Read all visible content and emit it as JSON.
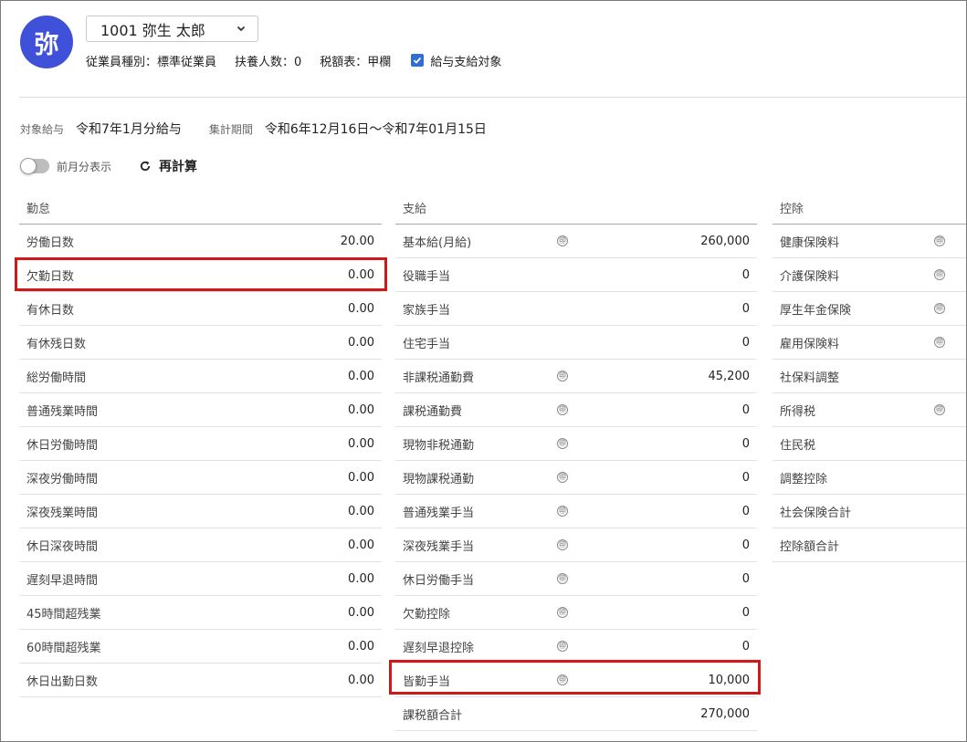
{
  "employee": {
    "avatar_char": "弥",
    "selector_value": "1001 弥生 太郎",
    "type": "従業員種別：標準従業員",
    "dependents": "扶養人数：0",
    "tax_table": "税額表：甲欄",
    "payroll_target_label": "給与支給対象",
    "payroll_target_checked": true
  },
  "period": {
    "target_label": "対象給与",
    "target_value": "令和7年1月分給与",
    "range_label": "集計期間",
    "range_value": "令和6年12月16日〜令和7年01月15日"
  },
  "controls": {
    "prev_month_label": "前月分表示",
    "recalc_label": "再計算"
  },
  "attendance": {
    "header": "勤怠",
    "rows": [
      {
        "name": "労働日数",
        "value": "20.00"
      },
      {
        "name": "欠勤日数",
        "value": "0.00"
      },
      {
        "name": "有休日数",
        "value": "0.00"
      },
      {
        "name": "有休残日数",
        "value": "0.00"
      },
      {
        "name": "総労働時間",
        "value": "0.00"
      },
      {
        "name": "普通残業時間",
        "value": "0.00"
      },
      {
        "name": "休日労働時間",
        "value": "0.00"
      },
      {
        "name": "深夜労働時間",
        "value": "0.00"
      },
      {
        "name": "深夜残業時間",
        "value": "0.00"
      },
      {
        "name": "休日深夜時間",
        "value": "0.00"
      },
      {
        "name": "遅刻早退時間",
        "value": "0.00"
      },
      {
        "name": "45時間超残業",
        "value": "0.00"
      },
      {
        "name": "60時間超残業",
        "value": "0.00"
      },
      {
        "name": "休日出勤日数",
        "value": "0.00"
      }
    ]
  },
  "payment": {
    "header": "支給",
    "rows": [
      {
        "name": "基本給(月給)",
        "value": "260,000",
        "mark": "㊞"
      },
      {
        "name": "役職手当",
        "value": "0",
        "mark": ""
      },
      {
        "name": "家族手当",
        "value": "0",
        "mark": ""
      },
      {
        "name": "住宅手当",
        "value": "0",
        "mark": ""
      },
      {
        "name": "非課税通勤費",
        "value": "45,200",
        "mark": "㊞"
      },
      {
        "name": "課税通勤費",
        "value": "0",
        "mark": "㊞"
      },
      {
        "name": "現物非税通勤",
        "value": "0",
        "mark": "㊞"
      },
      {
        "name": "現物課税通勤",
        "value": "0",
        "mark": "㊞"
      },
      {
        "name": "普通残業手当",
        "value": "0",
        "mark": "㊞"
      },
      {
        "name": "深夜残業手当",
        "value": "0",
        "mark": "㊞"
      },
      {
        "name": "休日労働手当",
        "value": "0",
        "mark": "㊞"
      },
      {
        "name": "欠勤控除",
        "value": "0",
        "mark": "㊞"
      },
      {
        "name": "遅刻早退控除",
        "value": "0",
        "mark": "㊞"
      },
      {
        "name": "皆勤手当",
        "value": "10,000",
        "mark": "㊞"
      },
      {
        "name": "課税額合計",
        "value": "270,000",
        "mark": ""
      }
    ]
  },
  "deduction": {
    "header": "控除",
    "rows": [
      {
        "name": "健康保険料",
        "value": "",
        "mark": "㊞"
      },
      {
        "name": "介護保険料",
        "value": "",
        "mark": "㊞"
      },
      {
        "name": "厚生年金保険",
        "value": "",
        "mark": "㊞"
      },
      {
        "name": "雇用保険料",
        "value": "",
        "mark": "㊞"
      },
      {
        "name": "社保料調整",
        "value": "",
        "mark": ""
      },
      {
        "name": "所得税",
        "value": "",
        "mark": "㊞"
      },
      {
        "name": "住民税",
        "value": "",
        "mark": ""
      },
      {
        "name": "調整控除",
        "value": "",
        "mark": ""
      },
      {
        "name": "社会保険合計",
        "value": "",
        "mark": ""
      },
      {
        "name": "控除額合計",
        "value": "",
        "mark": ""
      }
    ]
  },
  "colors": {
    "avatar": "#3f51d9",
    "checkbox": "#2f6fd3",
    "highlight": "#d01818"
  }
}
